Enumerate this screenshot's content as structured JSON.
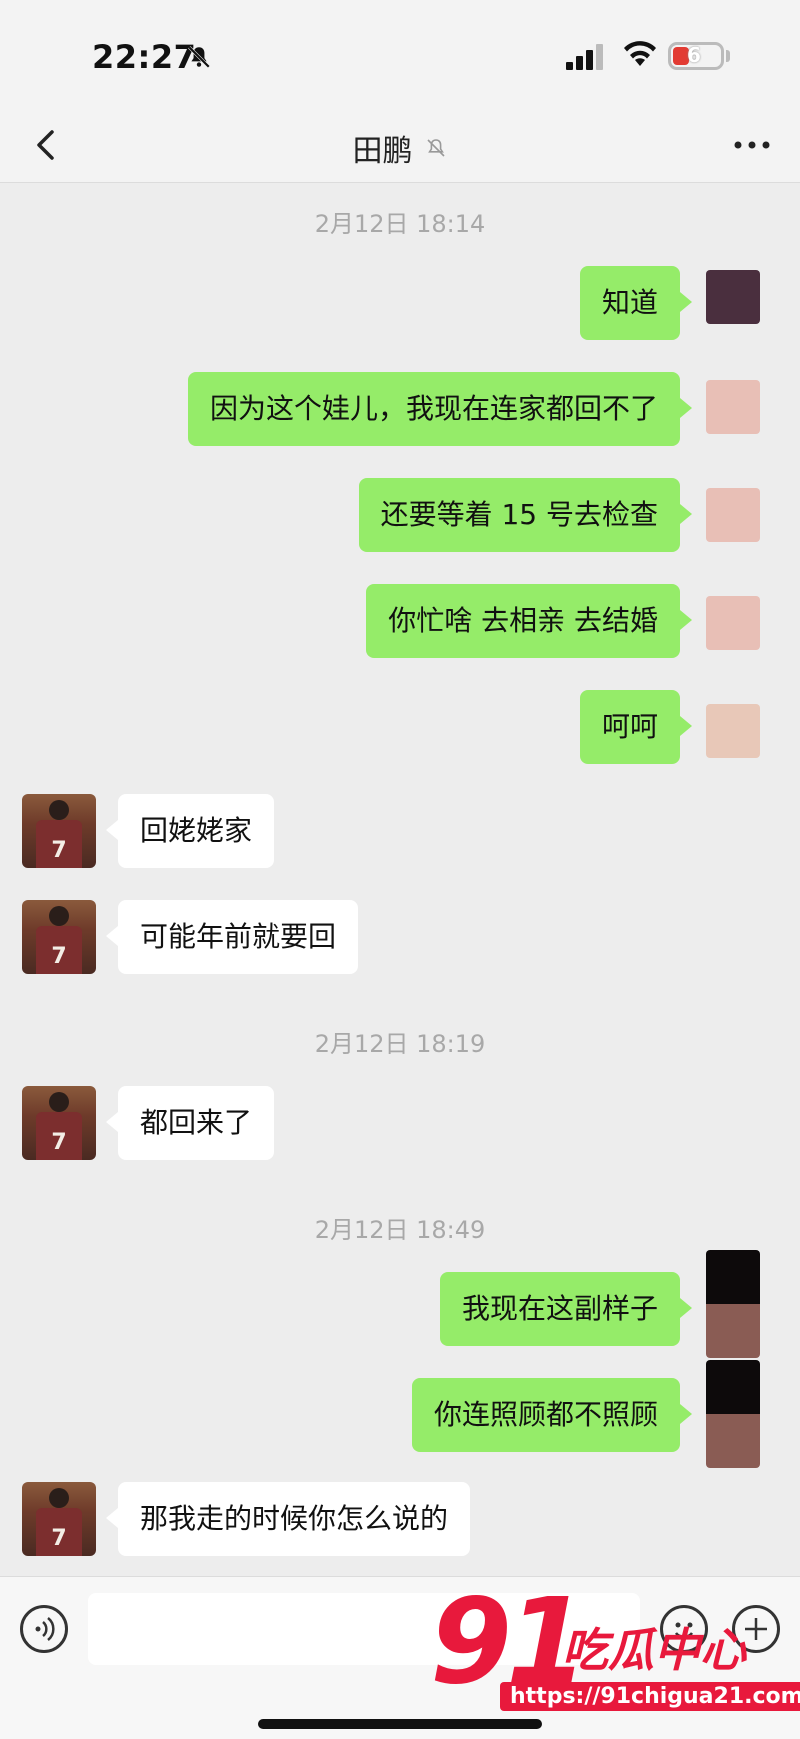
{
  "status_bar": {
    "time": "22:27",
    "battery": "6"
  },
  "header": {
    "title": "田鹏"
  },
  "messages": [
    {
      "type": "timestamp",
      "text": "2月12日 18:14"
    },
    {
      "from": "self",
      "text": "知道"
    },
    {
      "from": "self",
      "text": "因为这个娃儿，我现在连家都回不了"
    },
    {
      "from": "self",
      "text": "还要等着 15 号去检查"
    },
    {
      "from": "self",
      "text": "你忙啥 去相亲 去结婚"
    },
    {
      "from": "self",
      "text": "呵呵"
    },
    {
      "from": "friend",
      "text": "回姥姥家"
    },
    {
      "from": "friend",
      "text": "可能年前就要回"
    },
    {
      "type": "timestamp",
      "text": "2月12日 18:19"
    },
    {
      "from": "friend",
      "text": "都回来了"
    },
    {
      "type": "timestamp",
      "text": "2月12日 18:49"
    },
    {
      "from": "self",
      "text": "我现在这副样子"
    },
    {
      "from": "self",
      "text": "你连照顾都不照顾"
    },
    {
      "from": "friend",
      "text": "那我走的时候你怎么说的"
    }
  ],
  "avatar": {
    "jersey_number": "7"
  },
  "watermark": {
    "number": "91",
    "name": "吃瓜中心",
    "url": "https://91chigua21.com"
  },
  "colors": {
    "self_bubble": "#95ec69",
    "friend_bubble": "#ffffff",
    "background": "#ededed",
    "watermark": "#e8193c"
  }
}
